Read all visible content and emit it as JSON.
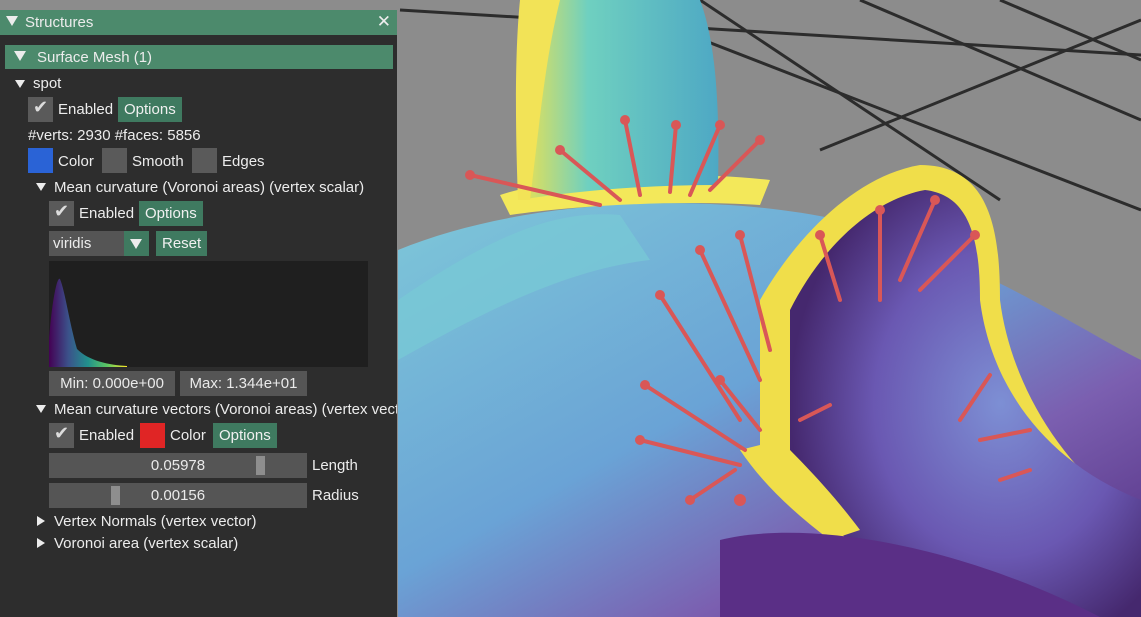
{
  "panel": {
    "title": "Structures",
    "close_glyph": "✕",
    "section_header": "Surface Mesh (1)",
    "mesh": {
      "name": "spot",
      "enabled_label": "Enabled",
      "options_label": "Options",
      "counts": "#verts: 2930  #faces: 5856",
      "color_label": "Color",
      "smooth_label": "Smooth",
      "edges_label": "Edges",
      "color": "#2a63d6"
    },
    "quantities": [
      {
        "title": "Mean curvature (Voronoi areas) (vertex scalar)",
        "enabled_label": "Enabled",
        "options_label": "Options",
        "colormap": "viridis",
        "reset_label": "Reset",
        "min_label": "Min: 0.000e+00",
        "max_label": "Max: 1.344e+01"
      },
      {
        "title": "Mean curvature vectors (Voronoi areas) (vertex vect",
        "enabled_label": "Enabled",
        "color_label": "Color",
        "options_label": "Options",
        "color": "#e02525",
        "length_value": "0.05978",
        "length_label": "Length",
        "length_fraction": 0.83,
        "radius_value": "0.00156",
        "radius_label": "Radius",
        "radius_fraction": 0.25
      },
      {
        "title": "Vertex Normals (vertex vector)"
      },
      {
        "title": "Voronoi area (vertex scalar)"
      }
    ]
  }
}
